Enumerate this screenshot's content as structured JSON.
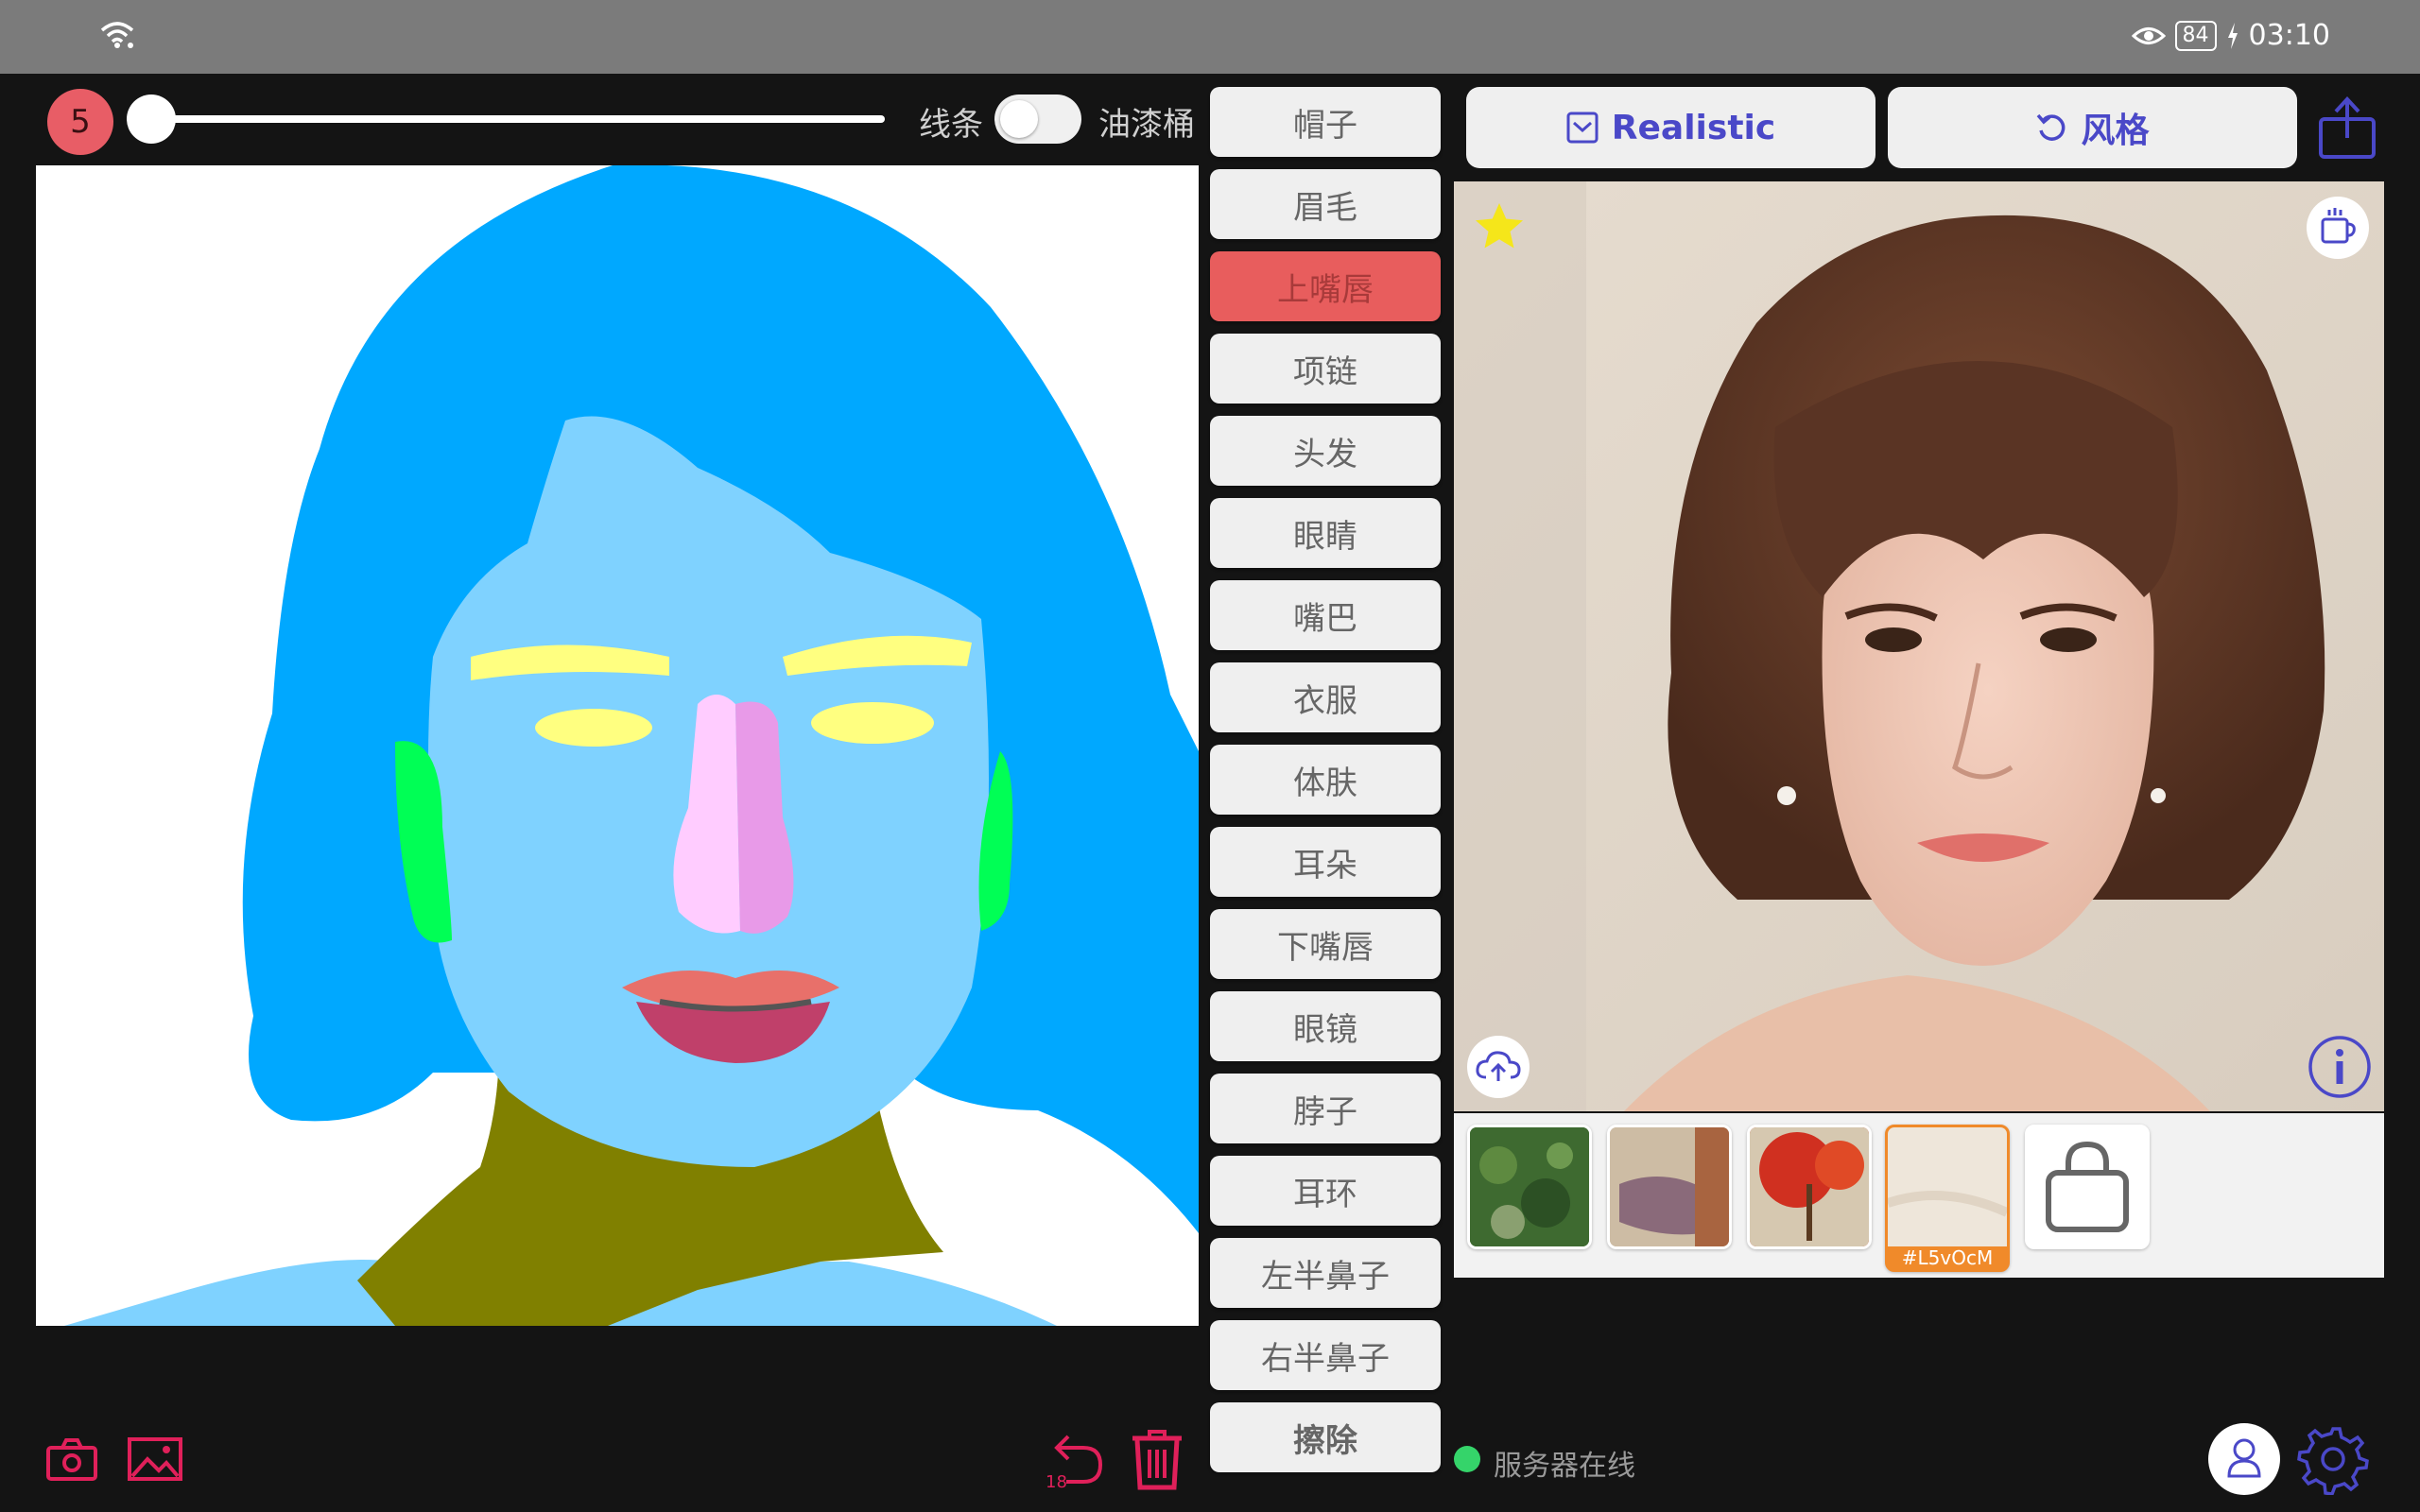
{
  "status_bar": {
    "battery": "84",
    "time": "03:10"
  },
  "brush": {
    "size": "5",
    "slider_value": 0.0
  },
  "mode": {
    "left_label": "线条",
    "right_label": "油漆桶",
    "toggle_on": false
  },
  "segments": [
    "帽子",
    "眉毛",
    "上嘴唇",
    "项链",
    "头发",
    "眼睛",
    "嘴巴",
    "衣服",
    "体肤",
    "耳朵",
    "下嘴唇",
    "眼镜",
    "脖子",
    "耳环",
    "左半鼻子",
    "右半鼻子",
    "擦除"
  ],
  "active_segment": "上嘴唇",
  "top_buttons": {
    "realistic": "Realistic",
    "style": "风格"
  },
  "thumbnails": {
    "selected_label": "#L5vOcM"
  },
  "undo": {
    "count": "18"
  },
  "server": {
    "status": "服务器在线"
  },
  "colors": {
    "accent": "#4a48c8",
    "danger": "#e0205a",
    "active_segment": "#e85d5d",
    "hair": "#00a8ff",
    "skin": "#7fd2ff",
    "neck": "#808000",
    "brow": "#ffff80",
    "ear": "#00ff55",
    "lip_upper": "#e8706a",
    "lip_lower": "#c0406a",
    "nose_left": "#ffccff",
    "nose_right": "#e89ae8",
    "online": "#35d46a"
  },
  "icons": [
    "wifi-icon",
    "eye-icon",
    "battery-icon",
    "charging-icon",
    "checkbox-icon",
    "undo-style-icon",
    "share-icon",
    "star-icon",
    "coffee-icon",
    "cloud-upload-icon",
    "info-icon",
    "bag-icon",
    "camera-icon",
    "image-icon",
    "undo-icon",
    "trash-icon",
    "user-icon",
    "gear-icon"
  ]
}
